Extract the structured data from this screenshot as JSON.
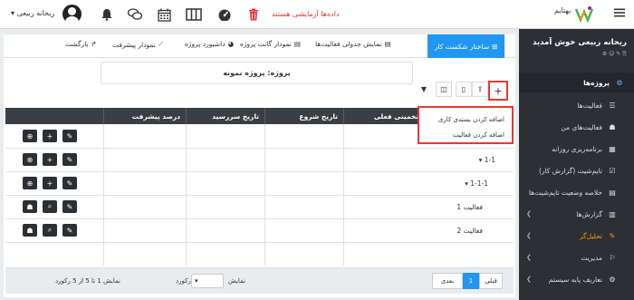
{
  "topbar": {
    "user_name": "ریحانه ربیعی",
    "trial_text": "داده‌ها آزمایشی هستند",
    "brand": "بهتایم"
  },
  "sidebar": {
    "welcome": "ریحانه ربیعی خوش آمدید",
    "sub": "⚙ ☺ ✎ ⎘",
    "items": [
      {
        "label": "پروژه‌ها",
        "icon": "projects-icon"
      },
      {
        "label": "فعالیت‌ها",
        "icon": "list-icon"
      },
      {
        "label": "فعالیت‌های من",
        "icon": "user-tasks-icon"
      },
      {
        "label": "برنامه‌ریزی روزانه",
        "icon": "calendar-icon"
      },
      {
        "label": "تایم‌شیت (گزارش کار)",
        "icon": "timesheet-icon"
      },
      {
        "label": "خلاصه وضعیت تایم‌شیت‌ها",
        "icon": "table-icon"
      },
      {
        "label": "گزارش‌ها",
        "icon": "reports-icon"
      },
      {
        "label": "تحلیل‌گر",
        "icon": "analyzer-icon"
      },
      {
        "label": "مدیریت",
        "icon": "admin-icon"
      },
      {
        "label": "تعاریف پایه سیستم",
        "icon": "settings-icon"
      }
    ]
  },
  "tabs": {
    "wbs": "ساختار شکست کار",
    "table": "نمایش جدولی فعالیت‌ها",
    "gantt": "نمودار گانت پروژه",
    "dashboard": "داشبورد پروژه",
    "progress": "نمودار پیشرفت",
    "back": "بازگشت"
  },
  "project": {
    "title": "پروژه: پروژه نمونه"
  },
  "dropdown": {
    "add_package": "اضافه کردن بسته‌ی کاری",
    "add_activity": "اضافه کردن فعالیت"
  },
  "grid": {
    "headers": {
      "progress": "درصد پیشرفت",
      "due": "تاریخ سررسید",
      "start": "تاریخ شروع",
      "estimate": "زمان تخمینی فعلی"
    },
    "rows": [
      {
        "name": ""
      },
      {
        "name": "1-1"
      },
      {
        "name": "1-1-1"
      },
      {
        "name": "فعالیت 1"
      },
      {
        "name": "فعالیت 2"
      }
    ]
  },
  "footer": {
    "prev": "قبلی",
    "page": "1",
    "next": "بعدی",
    "show": "نمایش",
    "records": "رکورد",
    "summary": "نمایش 1 تا 5 از 5 رکورد"
  }
}
